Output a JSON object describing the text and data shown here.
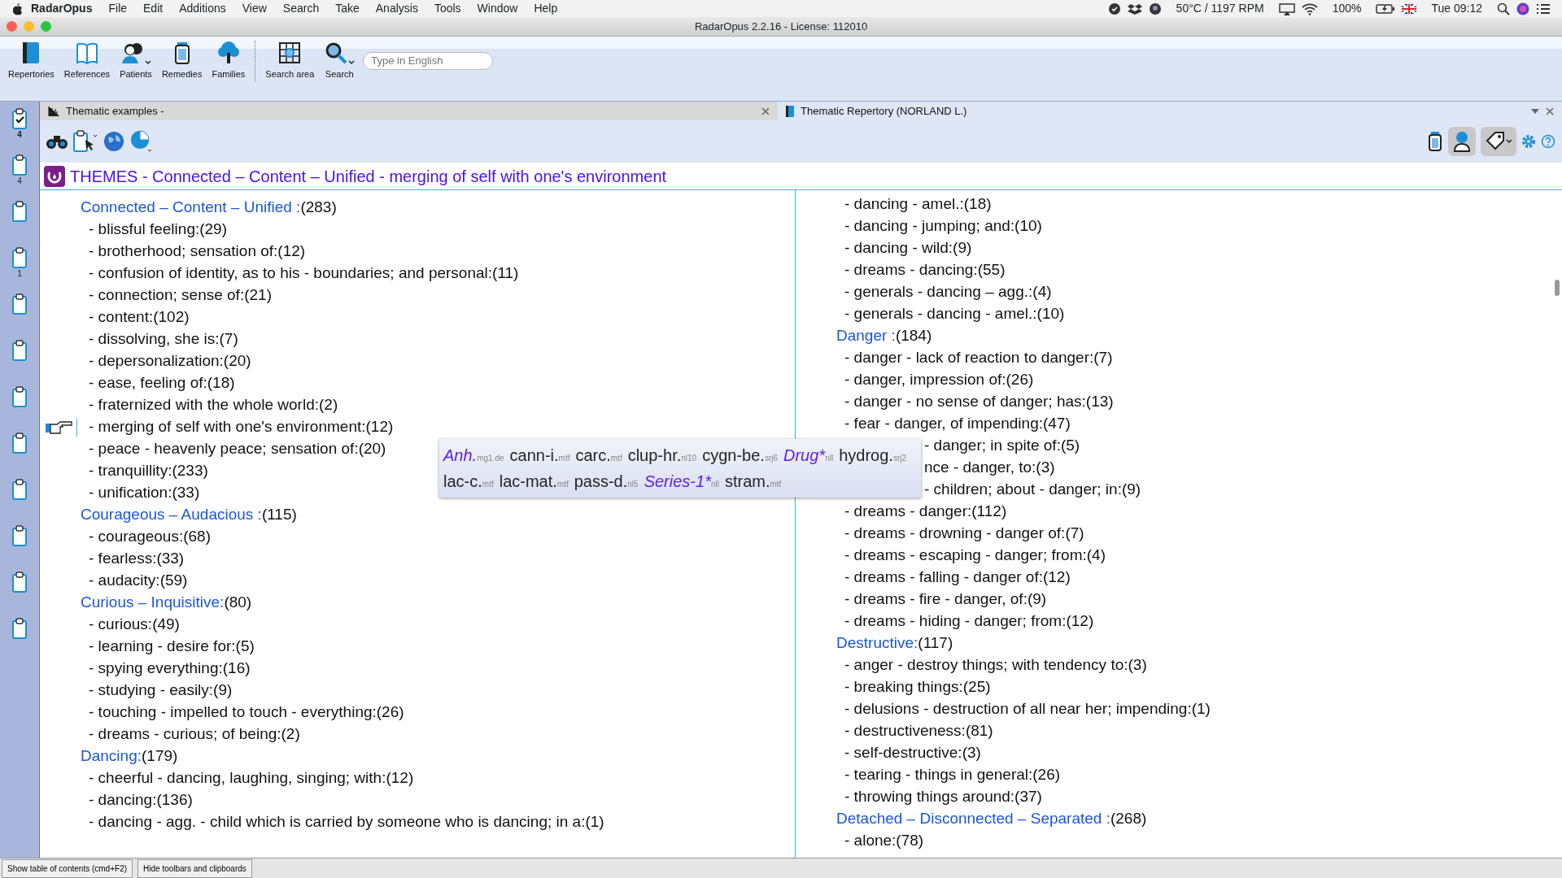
{
  "menubar": {
    "app": "RadarOpus",
    "items": [
      "File",
      "Edit",
      "Additions",
      "View",
      "Search",
      "Take",
      "Analysis",
      "Tools",
      "Window",
      "Help"
    ],
    "temperature": "50°C / 1197 RPM",
    "battery": "100%",
    "clock": "Tue 09:12"
  },
  "window": {
    "title": "RadarOpus 2.2.16 - License: 112010"
  },
  "toolbar": {
    "buttons": [
      {
        "label": "Repertories",
        "kind": "book",
        "dropdown": false
      },
      {
        "label": "References",
        "kind": "openbook",
        "dropdown": false
      },
      {
        "label": "Patients",
        "kind": "people",
        "dropdown": true
      },
      {
        "label": "Remedies",
        "kind": "jar",
        "dropdown": false
      },
      {
        "label": "Families",
        "kind": "tree",
        "dropdown": false
      },
      {
        "label": "Search area",
        "kind": "area",
        "dropdown": false
      },
      {
        "label": "Search",
        "kind": "search",
        "dropdown": true
      }
    ],
    "search": {
      "placeholder": "Type in English"
    }
  },
  "clipboards": [
    {
      "count": "4",
      "checked": true
    },
    {
      "count": "4",
      "checked": false
    },
    {
      "checked": false
    },
    {
      "count": "1",
      "checked": false
    },
    {
      "checked": false
    },
    {
      "checked": false
    },
    {
      "checked": false
    },
    {
      "checked": false
    },
    {
      "checked": false
    },
    {
      "checked": false
    },
    {
      "checked": false
    },
    {
      "checked": false
    }
  ],
  "tabs": [
    {
      "title": "Thematic examples -",
      "selected": true
    },
    {
      "title": "Thematic Repertory (NORLAND L.)",
      "selected": false
    }
  ],
  "heading": "THEMES - Connected – Content – Unified  - merging of self with one's environment",
  "left_column": [
    {
      "kind": "group",
      "label": "Connected – Content – Unified :",
      "count": "(283)",
      "marked": false
    },
    {
      "kind": "item",
      "text": "- blissful feeling:(29)",
      "marked": false
    },
    {
      "kind": "item",
      "text": "- brotherhood; sensation of:(12)",
      "marked": false
    },
    {
      "kind": "item",
      "text": "- confusion of identity, as to his - boundaries; and personal:(11)",
      "marked": false
    },
    {
      "kind": "item",
      "text": "- connection; sense of:(21)",
      "marked": false
    },
    {
      "kind": "item",
      "text": "- content:(102)",
      "marked": false
    },
    {
      "kind": "item",
      "text": "- dissolving, she is:(7)",
      "marked": false
    },
    {
      "kind": "item",
      "text": "- depersonalization:(20)",
      "marked": false
    },
    {
      "kind": "item",
      "text": "- ease, feeling of:(18)",
      "marked": false
    },
    {
      "kind": "item",
      "text": "- fraternized with the whole world:(2)",
      "marked": false
    },
    {
      "kind": "item",
      "text": "- merging of self with one's environment:(12)",
      "marked": true
    },
    {
      "kind": "item",
      "text": "- peace - heavenly peace; sensation of:(20)",
      "marked": false
    },
    {
      "kind": "item",
      "text": "- tranquillity:(233)",
      "marked": false
    },
    {
      "kind": "item",
      "text": "- unification:(33)",
      "marked": false
    },
    {
      "kind": "group",
      "label": "Courageous – Audacious :",
      "count": "(115)",
      "marked": false
    },
    {
      "kind": "item",
      "text": "- courageous:(68)",
      "marked": false
    },
    {
      "kind": "item",
      "text": "- fearless:(33)",
      "marked": false
    },
    {
      "kind": "item",
      "text": "- audacity:(59)",
      "marked": false
    },
    {
      "kind": "group",
      "label": "Curious – Inquisitive:",
      "count": "(80)",
      "marked": false
    },
    {
      "kind": "item",
      "text": "- curious:(49)",
      "marked": false
    },
    {
      "kind": "item",
      "text": "- learning - desire for:(5)",
      "marked": false
    },
    {
      "kind": "item",
      "text": "- spying everything:(16)",
      "marked": false
    },
    {
      "kind": "item",
      "text": "- studying - easily:(9)",
      "marked": false
    },
    {
      "kind": "item",
      "text": "- touching - impelled to touch - everything:(26)",
      "marked": false
    },
    {
      "kind": "item",
      "text": "- dreams - curious; of being:(2)",
      "marked": false
    },
    {
      "kind": "group",
      "label": "Dancing:",
      "count": "(179)",
      "marked": false
    },
    {
      "kind": "item",
      "text": "- cheerful - dancing, laughing, singing; with:(12)",
      "marked": false
    },
    {
      "kind": "item",
      "text": "- dancing:(136)",
      "marked": false
    },
    {
      "kind": "item",
      "text": "- dancing - agg. - child which is carried by someone who is dancing; in a:(1)",
      "marked": false
    }
  ],
  "right_column": [
    {
      "kind": "item",
      "text": "- dancing - amel.:(18)"
    },
    {
      "kind": "item",
      "text": "- dancing - jumping; and:(10)"
    },
    {
      "kind": "item",
      "text": "- dancing - wild:(9)"
    },
    {
      "kind": "item",
      "text": "- dreams - dancing:(55)"
    },
    {
      "kind": "item",
      "text": "- generals - dancing – agg.:(4)"
    },
    {
      "kind": "item",
      "text": "- generals - dancing - amel.:(10)"
    },
    {
      "kind": "group",
      "label": "Danger :",
      "count": "(184)"
    },
    {
      "kind": "item",
      "text": "- danger - lack of reaction to danger:(7)"
    },
    {
      "kind": "item",
      "text": "- danger, impression of:(26)"
    },
    {
      "kind": "item",
      "text": "- danger - no sense of danger; has:(13)"
    },
    {
      "kind": "item",
      "text": "- fear - danger, of impending:(47)"
    },
    {
      "kind": "partial",
      "text": "- danger; in spite of:(5)"
    },
    {
      "kind": "partial",
      "text": "nce - danger, to:(3)"
    },
    {
      "kind": "partial",
      "text": "- children; about - danger; in:(9)"
    },
    {
      "kind": "item",
      "text": "- dreams - danger:(112)"
    },
    {
      "kind": "item",
      "text": "- dreams - drowning - danger of:(7)"
    },
    {
      "kind": "item",
      "text": "- dreams - escaping - danger; from:(4)"
    },
    {
      "kind": "item",
      "text": "- dreams - falling - danger of:(12)"
    },
    {
      "kind": "item",
      "text": "- dreams - fire - danger, of:(9)"
    },
    {
      "kind": "item",
      "text": "- dreams - hiding - danger; from:(12)"
    },
    {
      "kind": "group",
      "label": "Destructive:",
      "count": "(117)"
    },
    {
      "kind": "item",
      "text": "- anger - destroy things; with tendency to:(3)"
    },
    {
      "kind": "item",
      "text": "- breaking things:(25)"
    },
    {
      "kind": "item",
      "text": "- delusions - destruction of all near her; impending:(1)"
    },
    {
      "kind": "item",
      "text": "- destructiveness:(81)"
    },
    {
      "kind": "item",
      "text": "- self-destructive:(3)"
    },
    {
      "kind": "item",
      "text": "- tearing - things in general:(26)"
    },
    {
      "kind": "item",
      "text": "- throwing things around:(37)"
    },
    {
      "kind": "group",
      "label": "Detached – Disconnected – Separated :",
      "count": "(268)"
    },
    {
      "kind": "item",
      "text": "- alone:(78)"
    }
  ],
  "tooltip": {
    "lines": [
      [
        {
          "kind": "family",
          "name": "Anh.",
          "source": "mg1.de"
        },
        {
          "kind": "remedy",
          "name": "cann-i.",
          "source": "mtf"
        },
        {
          "kind": "remedy",
          "name": "carc.",
          "source": "mtf"
        },
        {
          "kind": "remedy",
          "name": "clup-hr.",
          "source": "nl10"
        },
        {
          "kind": "remedy",
          "name": "cygn-be.",
          "source": "srj6"
        },
        {
          "kind": "family",
          "name": "Drug*",
          "source": "nll"
        },
        {
          "kind": "remedy",
          "name": "hydrog.",
          "source": "srj2"
        }
      ],
      [
        {
          "kind": "remedy",
          "name": "lac-c.",
          "source": "mtf"
        },
        {
          "kind": "remedy",
          "name": "lac-mat.",
          "source": "mtf"
        },
        {
          "kind": "remedy",
          "name": "pass-d.",
          "source": "nl5"
        },
        {
          "kind": "family",
          "name": "Series-1*",
          "source": "nll"
        },
        {
          "kind": "remedy",
          "name": "stram.",
          "source": "mtf"
        }
      ]
    ]
  },
  "status_bar": {
    "buttons": [
      "Show table of contents (cmd+F2)",
      "Hide toolbars and clipboards"
    ]
  }
}
